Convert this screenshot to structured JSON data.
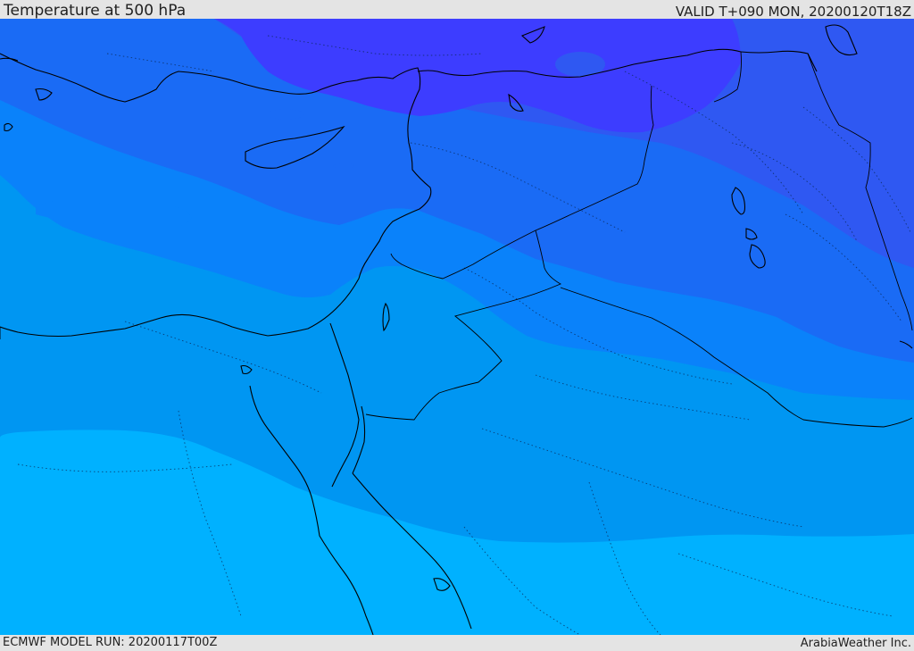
{
  "header": {
    "title": "Temperature at 500 hPa",
    "valid": "VALID T+090 MON, 20200120T18Z"
  },
  "footer": {
    "model_run": "ECMWF MODEL RUN: 20200117T00Z",
    "credit": "ArabiaWeather Inc."
  },
  "colors": {
    "band_coldest": "#3d3dff",
    "band_cold": "#2f58f2",
    "band_cool": "#1a6bf5",
    "band_mid": "#0a82fa",
    "band_mild": "#0096f2",
    "band_warm": "#00b1ff",
    "coastline": "#000000",
    "background": "#e4e4e4"
  }
}
